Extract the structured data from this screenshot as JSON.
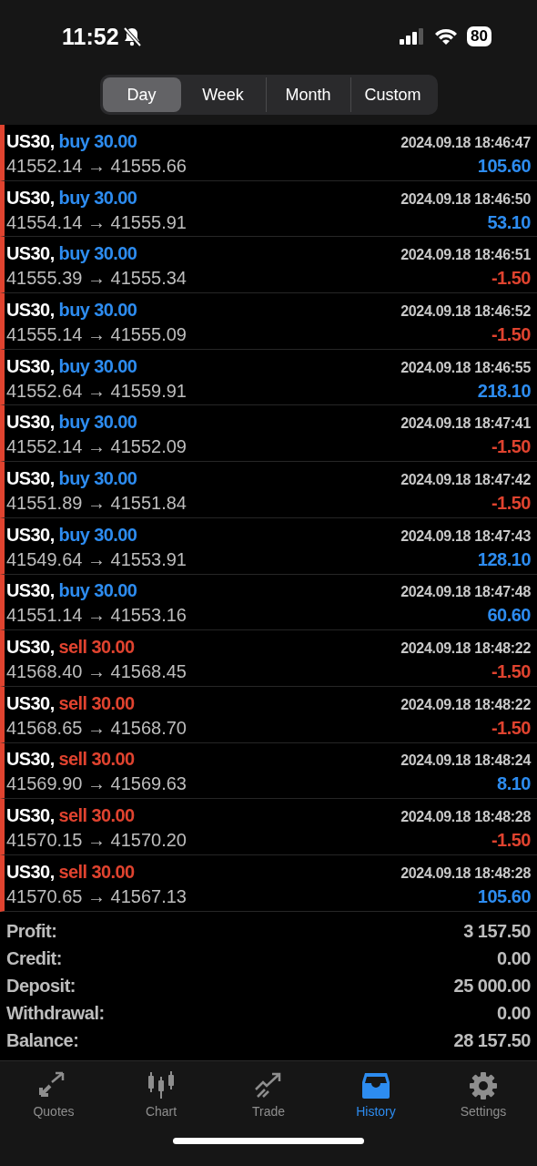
{
  "status_bar": {
    "time": "11:52",
    "silent": true,
    "battery": "80"
  },
  "tabs": [
    {
      "label": "Day",
      "selected": true
    },
    {
      "label": "Week",
      "selected": false
    },
    {
      "label": "Month",
      "selected": false
    },
    {
      "label": "Custom",
      "selected": false
    }
  ],
  "deals": [
    {
      "symbol": "US30,",
      "kind": "buy",
      "volume": "buy 30.00",
      "time": "2024.09.18 18:46:47",
      "prices": "41552.14 → 41555.66",
      "loss": false,
      "amount": "105.60"
    },
    {
      "symbol": "US30,",
      "kind": "buy",
      "volume": "buy 30.00",
      "time": "2024.09.18 18:46:50",
      "prices": "41554.14 → 41555.91",
      "loss": false,
      "amount": "53.10"
    },
    {
      "symbol": "US30,",
      "kind": "buy",
      "volume": "buy 30.00",
      "time": "2024.09.18 18:46:51",
      "prices": "41555.39 → 41555.34",
      "loss": true,
      "amount": "-1.50"
    },
    {
      "symbol": "US30,",
      "kind": "buy",
      "volume": "buy 30.00",
      "time": "2024.09.18 18:46:52",
      "prices": "41555.14 → 41555.09",
      "loss": true,
      "amount": "-1.50"
    },
    {
      "symbol": "US30,",
      "kind": "buy",
      "volume": "buy 30.00",
      "time": "2024.09.18 18:46:55",
      "prices": "41552.64 → 41559.91",
      "loss": false,
      "amount": "218.10"
    },
    {
      "symbol": "US30,",
      "kind": "buy",
      "volume": "buy 30.00",
      "time": "2024.09.18 18:47:41",
      "prices": "41552.14 → 41552.09",
      "loss": true,
      "amount": "-1.50"
    },
    {
      "symbol": "US30,",
      "kind": "buy",
      "volume": "buy 30.00",
      "time": "2024.09.18 18:47:42",
      "prices": "41551.89 → 41551.84",
      "loss": true,
      "amount": "-1.50"
    },
    {
      "symbol": "US30,",
      "kind": "buy",
      "volume": "buy 30.00",
      "time": "2024.09.18 18:47:43",
      "prices": "41549.64 → 41553.91",
      "loss": false,
      "amount": "128.10"
    },
    {
      "symbol": "US30,",
      "kind": "buy",
      "volume": "buy 30.00",
      "time": "2024.09.18 18:47:48",
      "prices": "41551.14 → 41553.16",
      "loss": false,
      "amount": "60.60"
    },
    {
      "symbol": "US30,",
      "kind": "sell",
      "volume": "sell 30.00",
      "time": "2024.09.18 18:48:22",
      "prices": "41568.40 → 41568.45",
      "loss": true,
      "amount": "-1.50"
    },
    {
      "symbol": "US30,",
      "kind": "sell",
      "volume": "sell 30.00",
      "time": "2024.09.18 18:48:22",
      "prices": "41568.65 → 41568.70",
      "loss": true,
      "amount": "-1.50"
    },
    {
      "symbol": "US30,",
      "kind": "sell",
      "volume": "sell 30.00",
      "time": "2024.09.18 18:48:24",
      "prices": "41569.90 → 41569.63",
      "loss": false,
      "amount": "8.10"
    },
    {
      "symbol": "US30,",
      "kind": "sell",
      "volume": "sell 30.00",
      "time": "2024.09.18 18:48:28",
      "prices": "41570.15 → 41570.20",
      "loss": true,
      "amount": "-1.50"
    },
    {
      "symbol": "US30,",
      "kind": "sell",
      "volume": "sell 30.00",
      "time": "2024.09.18 18:48:28",
      "prices": "41570.65 → 41567.13",
      "loss": false,
      "amount": "105.60"
    }
  ],
  "summary": [
    {
      "label": "Profit:",
      "value": "3 157.50"
    },
    {
      "label": "Credit:",
      "value": "0.00"
    },
    {
      "label": "Deposit:",
      "value": "25 000.00"
    },
    {
      "label": "Withdrawal:",
      "value": "0.00"
    },
    {
      "label": "Balance:",
      "value": "28 157.50"
    }
  ],
  "tab_bar": [
    {
      "label": "Quotes",
      "kind": "quotes",
      "selected": false
    },
    {
      "label": "Chart",
      "kind": "chart",
      "selected": false
    },
    {
      "label": "Trade",
      "kind": "trade",
      "selected": false
    },
    {
      "label": "History",
      "kind": "history",
      "selected": true
    },
    {
      "label": "Settings",
      "kind": "settings",
      "selected": false
    }
  ]
}
